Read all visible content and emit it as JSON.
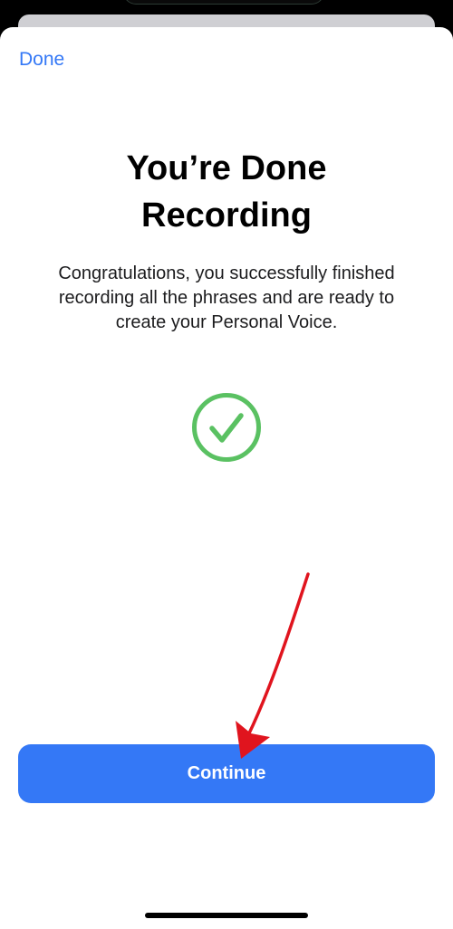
{
  "header": {
    "done_label": "Done"
  },
  "main": {
    "title_line1": "You’re Done",
    "title_line2": "Recording",
    "description": "Congratulations, you successfully finished recording all the phrases and are ready to create your Personal Voice.",
    "status_icon": "checkmark-circle-icon"
  },
  "footer": {
    "continue_label": "Continue"
  },
  "colors": {
    "accent": "#3478f6",
    "success": "#5ac162",
    "annotation": "#e0141e"
  }
}
